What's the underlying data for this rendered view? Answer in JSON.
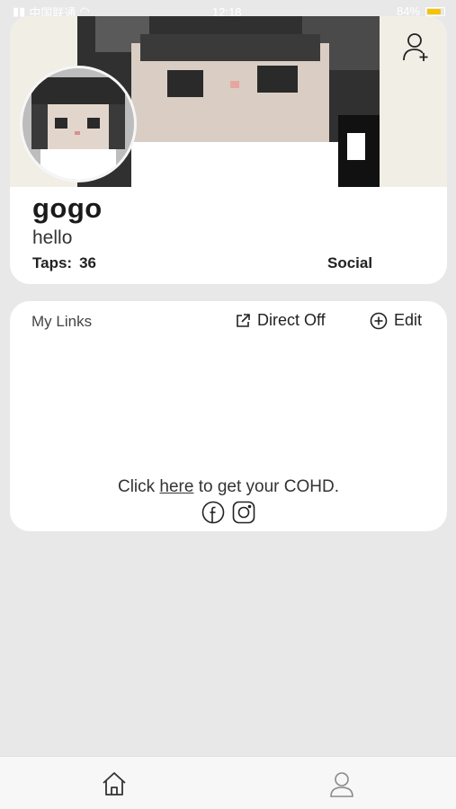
{
  "status_bar": {
    "carrier": "中国联通",
    "time": "12:18",
    "battery": "84%",
    "battery_level": 0.84,
    "battery_color": "#f5c400"
  },
  "profile": {
    "username": "gogo",
    "bio": "hello",
    "taps_label": "Taps:",
    "taps_value": "36",
    "social_label": "Social",
    "add_friend_icon": "user-plus-icon"
  },
  "links": {
    "title": "My Links",
    "direct_label": "Direct Off",
    "edit_label": "Edit",
    "cohd_prefix": "Click",
    "cohd_link": "here",
    "cohd_suffix": "to get your COHD.",
    "social_icons": [
      "facebook-icon",
      "instagram-icon"
    ]
  },
  "tab_bar": {
    "items": [
      "home-icon",
      "profile-icon"
    ]
  },
  "colors": {
    "background": "#e8e8e8",
    "card": "#ffffff",
    "cover_bg": "#f1eee6"
  }
}
